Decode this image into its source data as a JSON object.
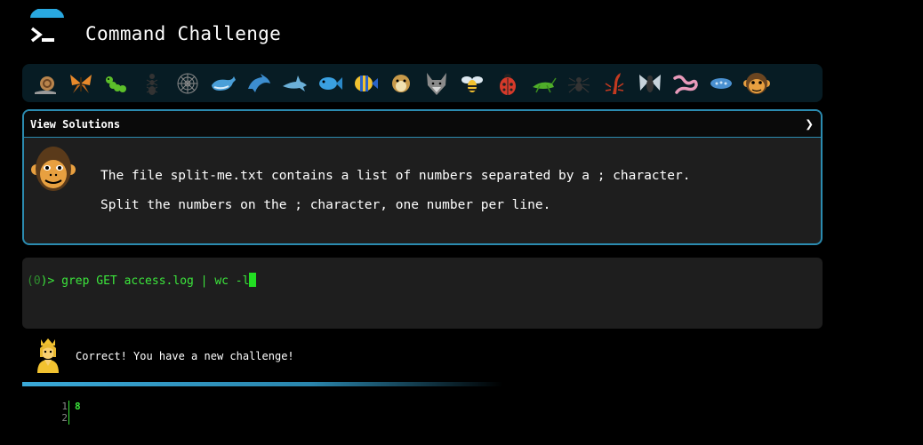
{
  "header": {
    "title": "Command Challenge",
    "logo_icon": "terminal-icon"
  },
  "badges": [
    {
      "icon": "snail-icon"
    },
    {
      "icon": "butterfly-icon"
    },
    {
      "icon": "caterpillar-icon"
    },
    {
      "icon": "ant-icon"
    },
    {
      "icon": "spiderweb-icon"
    },
    {
      "icon": "whale-icon"
    },
    {
      "icon": "dolphin-icon"
    },
    {
      "icon": "shark-icon"
    },
    {
      "icon": "fish-icon"
    },
    {
      "icon": "tropical-fish-icon"
    },
    {
      "icon": "pufferfish-icon"
    },
    {
      "icon": "wolf-icon"
    },
    {
      "icon": "bee-icon"
    },
    {
      "icon": "ladybug-icon"
    },
    {
      "icon": "cricket-icon"
    },
    {
      "icon": "spider-icon"
    },
    {
      "icon": "scorpion-icon"
    },
    {
      "icon": "fly-icon"
    },
    {
      "icon": "worm-icon"
    },
    {
      "icon": "microbe-icon"
    },
    {
      "icon": "monkey-icon"
    }
  ],
  "challenge": {
    "view_solutions_label": "View Solutions",
    "line1": "The file split-me.txt contains a list of numbers separated by a ; character.",
    "line2": "Split the numbers on the ; character, one number per line."
  },
  "terminal": {
    "prompt_open": "(",
    "prompt_num": "0",
    "prompt_close": ")> ",
    "command": "grep GET access.log | wc -l"
  },
  "feedback": {
    "message": "Correct! You have a new challenge!"
  },
  "output": {
    "line_numbers": [
      "1",
      "2"
    ],
    "text": "8"
  },
  "colors": {
    "accent": "#2b8bb0",
    "prompt": "#3ce63c",
    "panel": "#1e1e1e",
    "badge_bar": "#071c24"
  }
}
